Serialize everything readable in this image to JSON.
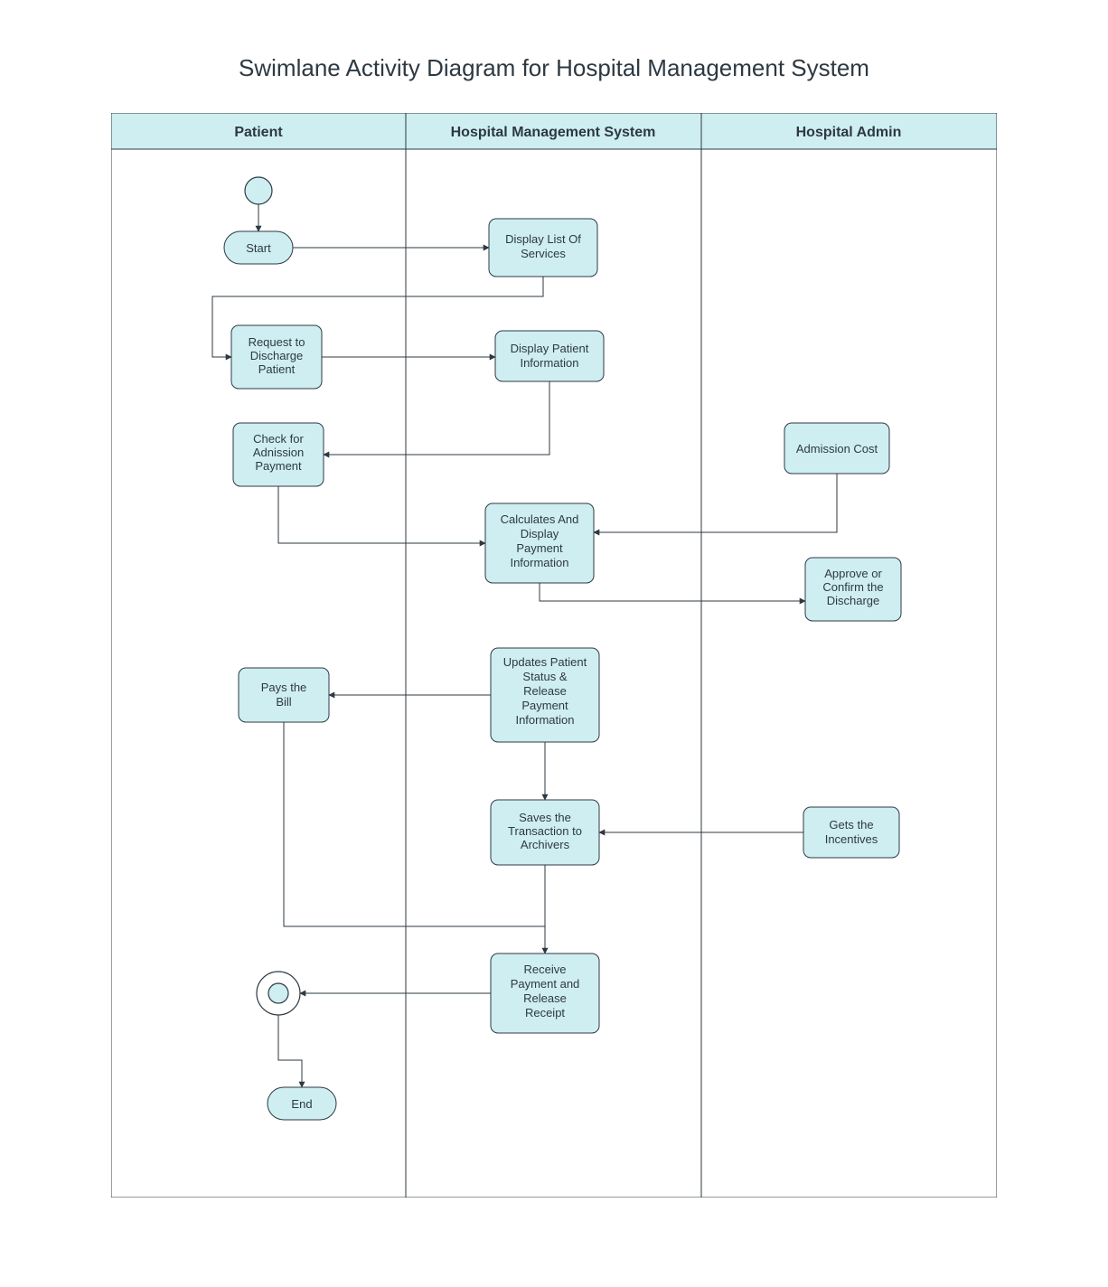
{
  "title": "Swimlane Activity Diagram for Hospital Management System",
  "lanes": {
    "patient": "Patient",
    "hms": "Hospital Management System",
    "admin": "Hospital Admin"
  },
  "nodes": {
    "start": "Start",
    "display_services_l1": "Display List Of",
    "display_services_l2": "Services",
    "request_discharge_l1": "Request to",
    "request_discharge_l2": "Discharge",
    "request_discharge_l3": "Patient",
    "display_patient_l1": "Display Patient",
    "display_patient_l2": "Information",
    "check_payment_l1": "Check for",
    "check_payment_l2": "Adnission",
    "check_payment_l3": "Payment",
    "admission_cost": "Admission Cost",
    "calc_display_l1": "Calculates And",
    "calc_display_l2": "Display",
    "calc_display_l3": "Payment",
    "calc_display_l4": "Information",
    "approve_l1": "Approve or",
    "approve_l2": "Confirm the",
    "approve_l3": "Discharge",
    "pays_bill_l1": "Pays the",
    "pays_bill_l2": "Bill",
    "updates_l1": "Updates Patient",
    "updates_l2": "Status &",
    "updates_l3": "Release",
    "updates_l4": "Payment",
    "updates_l5": "Information",
    "saves_l1": "Saves the",
    "saves_l2": "Transaction to",
    "saves_l3": "Archivers",
    "incentives_l1": "Gets the",
    "incentives_l2": "Incentives",
    "receive_l1": "Receive",
    "receive_l2": "Payment and",
    "receive_l3": "Release",
    "receive_l4": "Receipt",
    "end": "End"
  }
}
